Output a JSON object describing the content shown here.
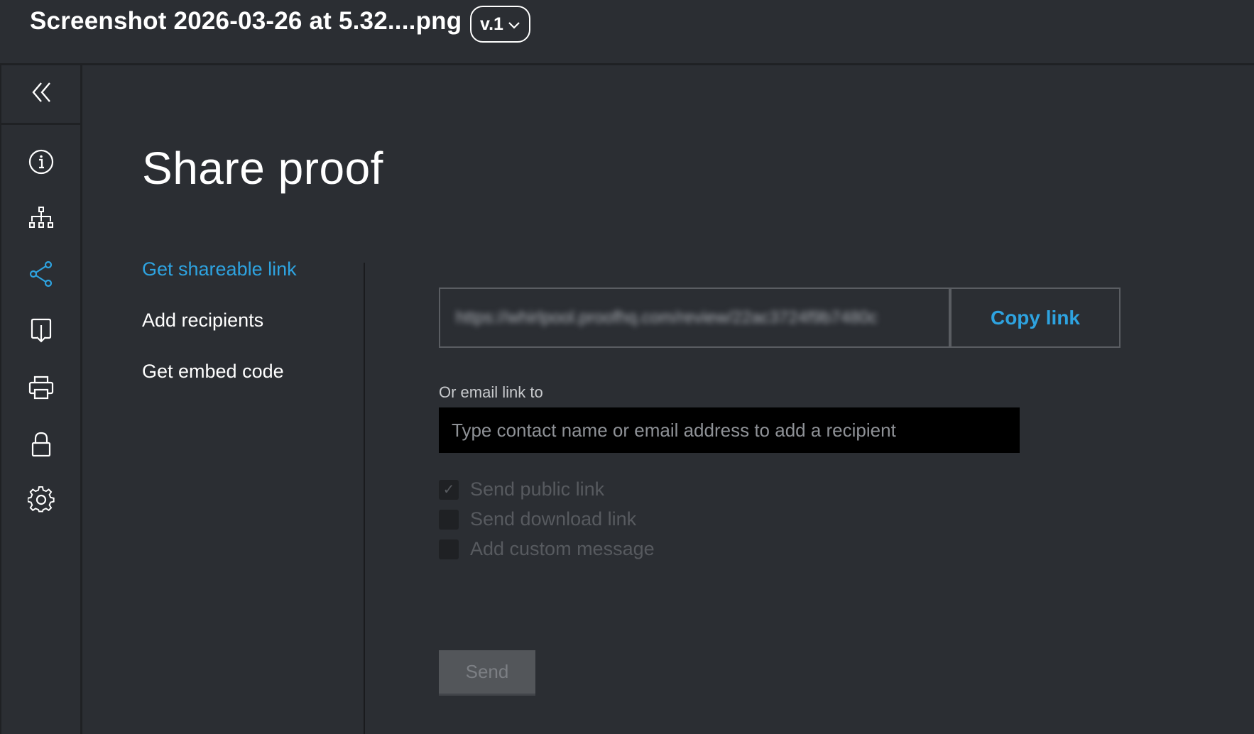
{
  "header": {
    "file_title": "Screenshot 2026-03-26 at 5.32....png",
    "version_label": "v.1"
  },
  "sidebar": {
    "collapse_icon": "double-chevron-left-icon",
    "items": [
      {
        "icon": "info-icon",
        "active": false
      },
      {
        "icon": "hierarchy-icon",
        "active": false
      },
      {
        "icon": "share-icon",
        "active": true
      },
      {
        "icon": "download-icon",
        "active": false
      },
      {
        "icon": "print-icon",
        "active": false
      },
      {
        "icon": "lock-icon",
        "active": false
      },
      {
        "icon": "gear-icon",
        "active": false
      }
    ]
  },
  "main": {
    "title": "Share proof",
    "subnav": [
      {
        "label": "Get shareable link",
        "active": true
      },
      {
        "label": "Add recipients",
        "active": false
      },
      {
        "label": "Get embed code",
        "active": false
      }
    ],
    "share_link": "https://whirlpool.proofhq.com/review/22ac3724f9b7480c",
    "copy_button": "Copy link",
    "email_label": "Or email link to",
    "email_placeholder": "Type contact name or email address to add a recipient",
    "options": [
      {
        "label": "Send public link",
        "checked": true
      },
      {
        "label": "Send download link",
        "checked": false
      },
      {
        "label": "Add custom message",
        "checked": false
      }
    ],
    "send_button": "Send"
  },
  "colors": {
    "background": "#2b2e33",
    "accent": "#2ea3e0",
    "input_bg": "#000000",
    "disabled_text": "#575a5f"
  }
}
